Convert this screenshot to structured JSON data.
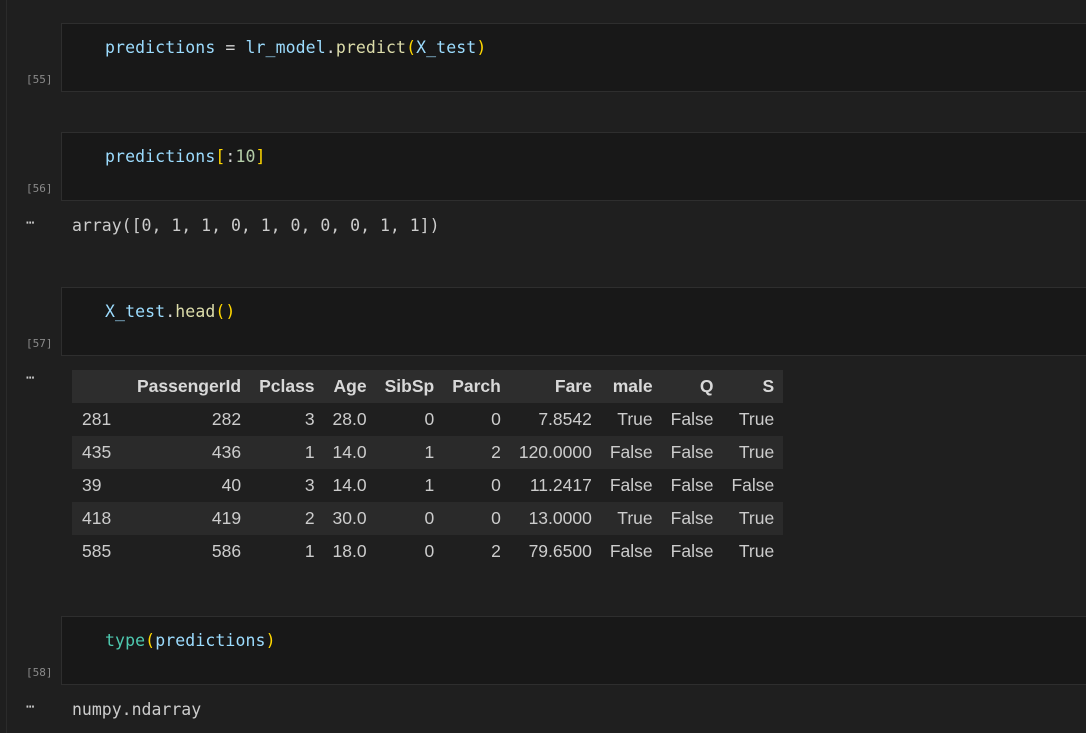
{
  "cells": [
    {
      "exec": "[55]",
      "code_tokens": [
        {
          "t": "predictions",
          "c": "var"
        },
        {
          "t": " = ",
          "c": "op"
        },
        {
          "t": "lr_model",
          "c": "var"
        },
        {
          "t": ".",
          "c": "op"
        },
        {
          "t": "predict",
          "c": "fn"
        },
        {
          "t": "(",
          "c": "b1"
        },
        {
          "t": "X_test",
          "c": "var"
        },
        {
          "t": ")",
          "c": "b1"
        }
      ]
    },
    {
      "exec": "[56]",
      "code_tokens": [
        {
          "t": "predictions",
          "c": "var"
        },
        {
          "t": "[",
          "c": "b1"
        },
        {
          "t": ":",
          "c": "op"
        },
        {
          "t": "10",
          "c": "num"
        },
        {
          "t": "]",
          "c": "b1"
        }
      ],
      "output": "array([0, 1, 1, 0, 1, 0, 0, 0, 1, 1])"
    },
    {
      "exec": "[57]",
      "code_tokens": [
        {
          "t": "X_test",
          "c": "var"
        },
        {
          "t": ".",
          "c": "op"
        },
        {
          "t": "head",
          "c": "fn"
        },
        {
          "t": "()",
          "c": "b1"
        }
      ]
    },
    {
      "exec": "[58]",
      "code_tokens": [
        {
          "t": "type",
          "c": "cls"
        },
        {
          "t": "(",
          "c": "b1"
        },
        {
          "t": "predictions",
          "c": "var"
        },
        {
          "t": ")",
          "c": "b1"
        }
      ],
      "output": "numpy.ndarray"
    }
  ],
  "output_ellipsis": "⋯",
  "dataframe": {
    "columns": [
      "",
      "PassengerId",
      "Pclass",
      "Age",
      "SibSp",
      "Parch",
      "Fare",
      "male",
      "Q",
      "S"
    ],
    "rows": [
      [
        "281",
        "282",
        "3",
        "28.0",
        "0",
        "0",
        "7.8542",
        "True",
        "False",
        "True"
      ],
      [
        "435",
        "436",
        "1",
        "14.0",
        "1",
        "2",
        "120.0000",
        "False",
        "False",
        "True"
      ],
      [
        "39",
        "40",
        "3",
        "14.0",
        "1",
        "0",
        "11.2417",
        "False",
        "False",
        "False"
      ],
      [
        "418",
        "419",
        "2",
        "30.0",
        "0",
        "0",
        "13.0000",
        "True",
        "False",
        "True"
      ],
      [
        "585",
        "586",
        "1",
        "18.0",
        "0",
        "2",
        "79.6500",
        "False",
        "False",
        "True"
      ]
    ]
  },
  "colors": {
    "background": "#1f1f1f",
    "cell_background": "#181818",
    "variable": "#9cdcfe",
    "function": "#dcdcaa",
    "number": "#b5cea8",
    "class": "#4ec9b0",
    "bracket": "#ffd700"
  }
}
